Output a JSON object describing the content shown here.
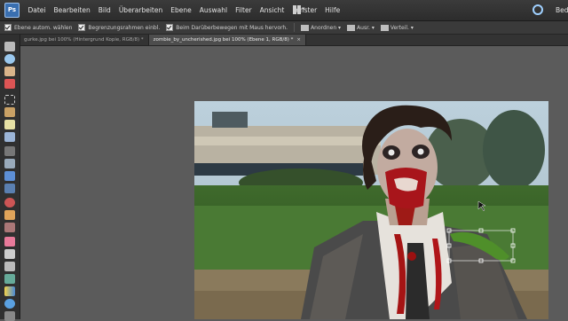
{
  "menubar": {
    "logo_text": "Ps",
    "items": [
      "Datei",
      "Bearbeiten",
      "Bild",
      "Überarbeiten",
      "Ebene",
      "Auswahl",
      "Filter",
      "Ansicht",
      "Fenster",
      "Hilfe"
    ],
    "right_label": "Bed"
  },
  "options": {
    "auto_select": "Ebene autom. wählen",
    "bounding_box": "Begrenzungsrahmen einbl.",
    "highlight_hover": "Beim Darüberbewegen mit Maus hervorh.",
    "arrange": "Anordnen",
    "align": "Ausr.",
    "distribute": "Verteil."
  },
  "tabs": [
    {
      "label": "gurke.jpg bei 100% (Hintergrund Kopie, RGB/8) *",
      "active": false
    },
    {
      "label": "zombie_by_uncherished.jpg bei 100% (Ebene 1, RGB/8) *",
      "active": true
    }
  ],
  "tab_close_glyph": "×",
  "colors": {
    "workspace": "#5b5b5b",
    "menubar": "#2c2c2c",
    "toolbox": "#303030",
    "accent": "#3a6fb0"
  },
  "icons": [
    "move-tool-icon",
    "zoom-tool-icon",
    "hand-tool-icon",
    "eyedropper-icon",
    "marquee-icon",
    "lasso-icon",
    "magic-wand-icon",
    "quick-selection-icon",
    "type-tool-icon",
    "crop-icon",
    "cookie-cutter-icon",
    "straighten-icon",
    "red-eye-icon",
    "spot-healing-icon",
    "clone-stamp-icon",
    "eraser-icon",
    "brush-icon",
    "smart-brush-icon",
    "paint-bucket-icon",
    "gradient-icon",
    "shape-icon",
    "sponge-icon",
    "foreground-color-icon"
  ]
}
